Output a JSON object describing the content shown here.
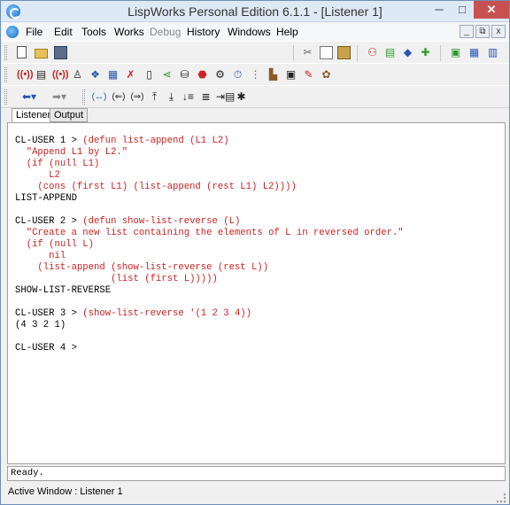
{
  "window": {
    "title": "LispWorks Personal Edition 6.1.1 - [Listener 1]",
    "minimize_glyph": "─",
    "maximize_glyph": "□",
    "close_glyph": "✕"
  },
  "menu": {
    "items": [
      "File",
      "Edit",
      "Tools",
      "Works",
      "Debug",
      "History",
      "Windows",
      "Help"
    ],
    "disabled": [
      "Debug"
    ],
    "mdi_buttons": [
      "_",
      "⧉",
      "x"
    ]
  },
  "toolbar1": {
    "icons": [
      "new-file-icon",
      "open-folder-icon",
      "save-icon",
      "cut-icon",
      "copy-icon",
      "paste-icon",
      "listener-icon",
      "editor-icon",
      "browser-icon",
      "inspector-icon",
      "podium-icon",
      "new-window-icon",
      "window-list-icon"
    ]
  },
  "toolbar2": {
    "icons": [
      "radio-icon",
      "document-icon",
      "output-icon",
      "function-icon",
      "class-icon",
      "generic-icon",
      "tool-icon",
      "clipboard-icon",
      "tree-icon",
      "package-icon",
      "stop-icon",
      "process-icon",
      "timer-icon",
      "search-icon",
      "boot-icon",
      "graph-icon",
      "brush-icon",
      "palette-icon"
    ]
  },
  "toolbar3": {
    "icons": [
      "back-icon",
      "forward-icon",
      "eval-icon",
      "undo-form-icon",
      "redo-form-icon",
      "step-in-icon",
      "step-out-icon",
      "list-icon",
      "indent-icon",
      "macroexpand-icon",
      "bug-icon"
    ]
  },
  "tabs": [
    "Listener",
    "Output"
  ],
  "active_tab": "Listener",
  "colors": {
    "input": "#cc2222",
    "output": "#000000",
    "close": "#c75050"
  },
  "listener": {
    "lines": [
      {
        "kind": "prompt",
        "prompt": "CL-USER 1 > ",
        "text": "(defun list-append (L1 L2)"
      },
      {
        "kind": "input",
        "text": "  \"Append L1 by L2.\""
      },
      {
        "kind": "input",
        "text": "  (if (null L1)"
      },
      {
        "kind": "input",
        "text": "      L2"
      },
      {
        "kind": "input",
        "text": "    (cons (first L1) (list-append (rest L1) L2))))"
      },
      {
        "kind": "output",
        "text": "LIST-APPEND"
      },
      {
        "kind": "blank",
        "text": ""
      },
      {
        "kind": "prompt",
        "prompt": "CL-USER 2 > ",
        "text": "(defun show-list-reverse (L)"
      },
      {
        "kind": "input",
        "text": "  \"Create a new list containing the elements of L in reversed order.\""
      },
      {
        "kind": "input",
        "text": "  (if (null L)"
      },
      {
        "kind": "input",
        "text": "      nil"
      },
      {
        "kind": "input",
        "text": "    (list-append (show-list-reverse (rest L))"
      },
      {
        "kind": "input",
        "text": "                 (list (first L)))))"
      },
      {
        "kind": "output",
        "text": "SHOW-LIST-REVERSE"
      },
      {
        "kind": "blank",
        "text": ""
      },
      {
        "kind": "prompt",
        "prompt": "CL-USER 3 > ",
        "text": "(show-list-reverse '(1 2 3 4))"
      },
      {
        "kind": "output",
        "text": "(4 3 2 1)"
      },
      {
        "kind": "blank",
        "text": ""
      },
      {
        "kind": "prompt",
        "prompt": "CL-USER 4 > ",
        "text": ""
      }
    ]
  },
  "status": {
    "message": "Ready.",
    "active_window": "Active Window : Listener 1"
  }
}
